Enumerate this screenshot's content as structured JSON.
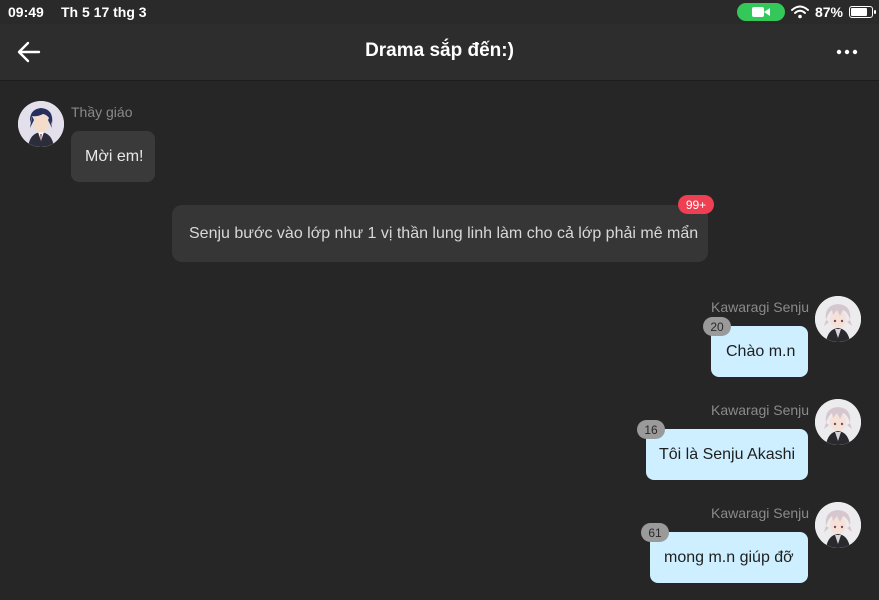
{
  "status_bar": {
    "time": "09:49",
    "date": "Th 5 17 thg 3",
    "battery": "87%",
    "battery_level": 0.87,
    "icons": [
      "camera-icon",
      "wifi-icon",
      "battery-icon"
    ],
    "camera_color": "#34c759"
  },
  "header": {
    "title": "Drama sắp đến:)",
    "icons": [
      "back-arrow-icon",
      "more-dots-icon"
    ]
  },
  "colors": {
    "background": "#262626",
    "incoming_bubble": "#3a3a3a",
    "outgoing_bubble": "#cdefff",
    "badge_red": "#ee4052",
    "badge_gray": "#9a9a9a"
  },
  "messages": [
    {
      "sender": "Thầy giáo",
      "text": "Mời em!",
      "side": "left"
    },
    {
      "type": "narration",
      "text": "Senju bước vào lớp như 1 vị thần lung linh làm cho cả lớp phải mê mẩn",
      "badge": "99+"
    },
    {
      "sender": "Kawaragi Senju",
      "text": "Chào m.n",
      "side": "right",
      "badge": "20"
    },
    {
      "sender": "Kawaragi Senju",
      "text": "Tôi là Senju Akashi",
      "side": "right",
      "badge": "16"
    },
    {
      "sender": "Kawaragi Senju",
      "text": "mong m.n giúp đỡ",
      "side": "right",
      "badge": "61"
    }
  ]
}
